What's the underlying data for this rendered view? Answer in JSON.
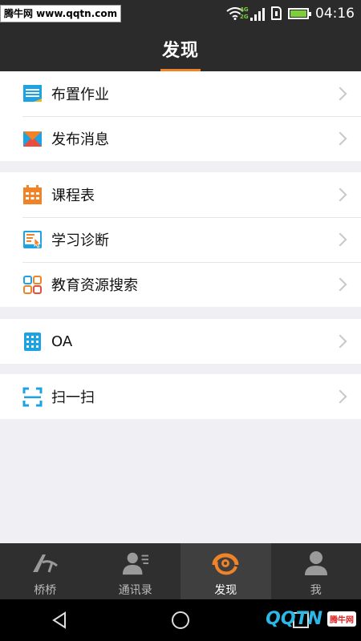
{
  "status_bar": {
    "watermark": "腾牛网 www.qqtn.com",
    "network_tag_top": "4G",
    "network_tag_bottom": "2G",
    "time": "04:16"
  },
  "header": {
    "title": "发现"
  },
  "groups": [
    {
      "items": [
        {
          "label": "布置作业",
          "icon": "homework-icon"
        },
        {
          "label": "发布消息",
          "icon": "message-envelope-icon"
        }
      ]
    },
    {
      "items": [
        {
          "label": "课程表",
          "icon": "calendar-icon"
        },
        {
          "label": "学习诊断",
          "icon": "diagnosis-icon"
        },
        {
          "label": "教育资源搜索",
          "icon": "resource-grid-icon"
        }
      ]
    },
    {
      "items": [
        {
          "label": "OA",
          "icon": "oa-icon"
        }
      ]
    },
    {
      "items": [
        {
          "label": "扫一扫",
          "icon": "scan-icon"
        }
      ]
    }
  ],
  "tabs": [
    {
      "label": "桥桥",
      "icon": "bridge-icon",
      "active": false
    },
    {
      "label": "通讯录",
      "icon": "contacts-icon",
      "active": false
    },
    {
      "label": "发现",
      "icon": "discover-icon",
      "active": true
    },
    {
      "label": "我",
      "icon": "person-icon",
      "active": false
    }
  ],
  "footer_watermark": {
    "brand": "QQTN",
    "badge": "腾牛网"
  },
  "colors": {
    "accent": "#f08228",
    "bar_dark": "#2b2b2b",
    "background": "#efeff4",
    "icon_blue": "#1ca3e3",
    "icon_orange": "#f08228"
  }
}
